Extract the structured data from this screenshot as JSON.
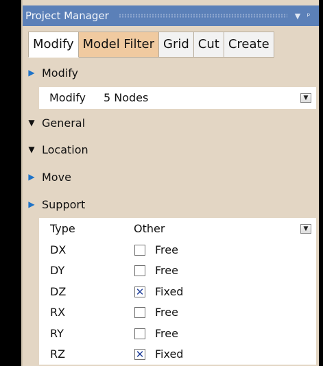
{
  "panel": {
    "title": "Project Manager"
  },
  "tabs": [
    {
      "label": "Modify"
    },
    {
      "label": "Model Filter"
    },
    {
      "label": "Grid"
    },
    {
      "label": "Cut"
    },
    {
      "label": "Create"
    }
  ],
  "sections": {
    "modify": "Modify",
    "general": "General",
    "location": "Location",
    "move": "Move",
    "support": "Support"
  },
  "modify_row": {
    "label": "Modify",
    "value": "5 Nodes"
  },
  "support": {
    "type_label": "Type",
    "type_value": "Other",
    "dofs": [
      {
        "name": "DX",
        "state": "Free",
        "checked": false
      },
      {
        "name": "DY",
        "state": "Free",
        "checked": false
      },
      {
        "name": "DZ",
        "state": "Fixed",
        "checked": true
      },
      {
        "name": "RX",
        "state": "Free",
        "checked": false
      },
      {
        "name": "RY",
        "state": "Free",
        "checked": false
      },
      {
        "name": "RZ",
        "state": "Fixed",
        "checked": true
      }
    ]
  },
  "colors": {
    "title_bar": "#5b80b8",
    "panel_bg": "#e3d6c4",
    "active_tab_highlight": "#f0caa0",
    "expander_collapsed": "#1e73c8"
  },
  "icons": {
    "dropdown": "chevron-down-icon",
    "collapsed": "triangle-right-icon",
    "expanded": "triangle-down-icon",
    "pin": "pin-icon"
  }
}
